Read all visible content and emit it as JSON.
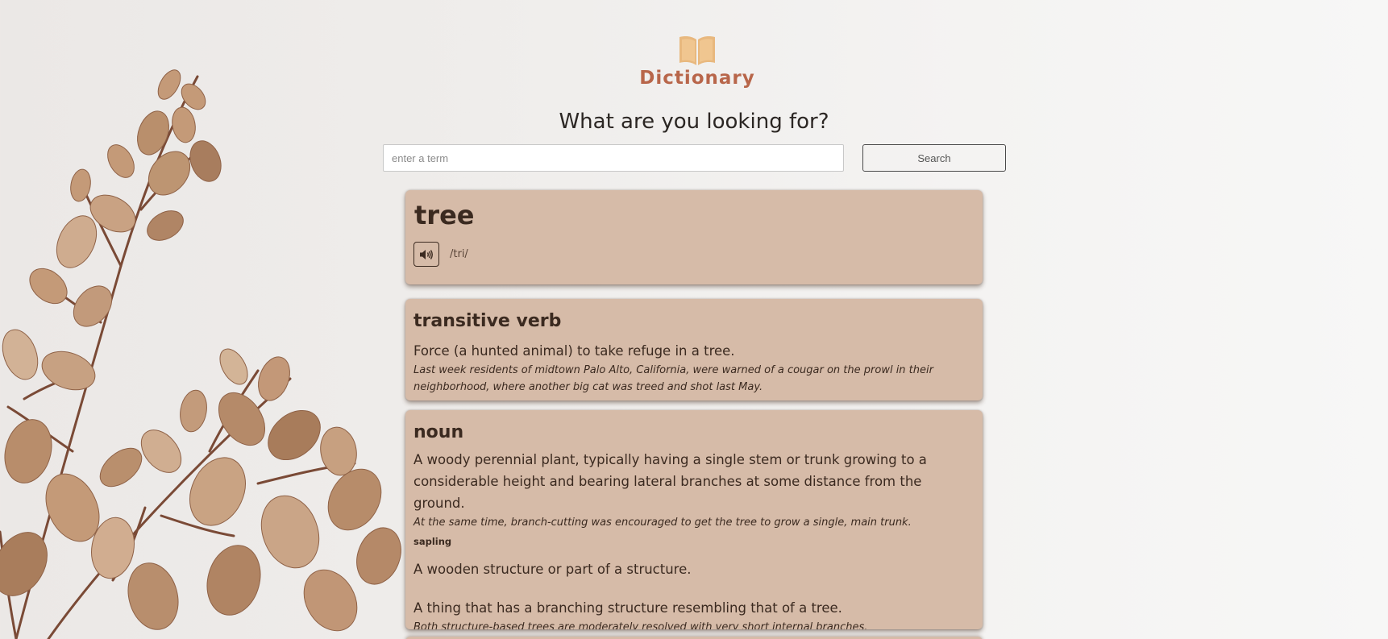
{
  "brand": {
    "name": "Dictionary",
    "color": "#b8664a",
    "icon": "open-book-icon"
  },
  "search": {
    "heading": "What are you looking for?",
    "placeholder": "enter a term",
    "value": "",
    "button_label": "Search"
  },
  "entry": {
    "word": "tree",
    "phonetic": "/tri/",
    "audio_icon": "speaker-icon",
    "meanings": [
      {
        "part_of_speech": "transitive verb",
        "definitions": [
          {
            "definition": "Force (a hunted animal) to take refuge in a tree.",
            "example": "Last week residents of midtown Palo Alto, California, were warned of a cougar on the prowl in their neighborhood, where another big cat was treed and shot last May."
          }
        ]
      },
      {
        "part_of_speech": "noun",
        "definitions": [
          {
            "definition": "A woody perennial plant, typically having a single stem or trunk growing to a considerable height and bearing lateral branches at some distance from the ground.",
            "example": "At the same time, branch-cutting was encouraged to get the tree to grow a single, main trunk.",
            "synonym": "sapling"
          },
          {
            "definition": "A wooden structure or part of a structure."
          },
          {
            "definition": "A thing that has a branching structure resembling that of a tree.",
            "example": "Both structure-based trees are moderately resolved with very short internal branches."
          }
        ]
      }
    ]
  },
  "colors": {
    "card": "#d6bba8",
    "text": "#3b2a20",
    "leaf": "#c49a78"
  }
}
